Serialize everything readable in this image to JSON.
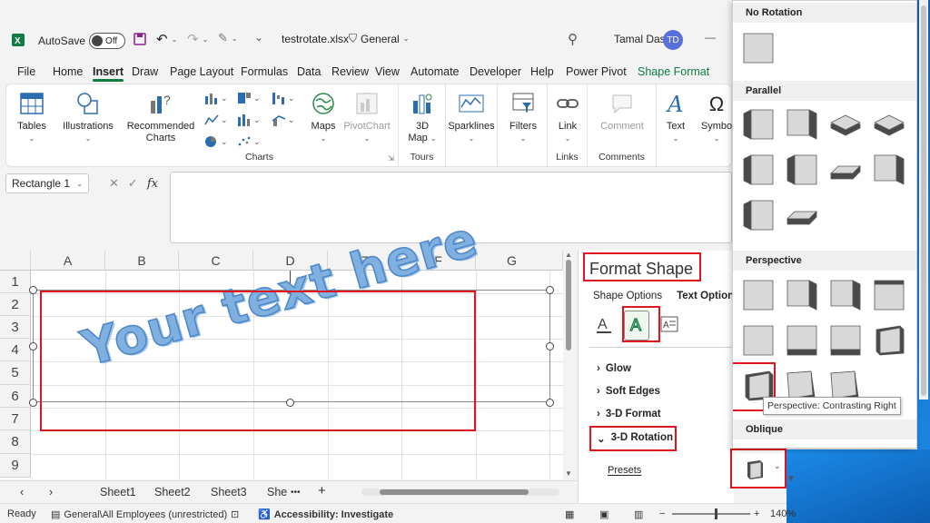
{
  "titlebar": {
    "autosave_label": "AutoSave",
    "autosave_state": "Off",
    "filename": "testrotate.xlsx",
    "sensitivity": "General",
    "user_name": "Tamal Das",
    "user_initials": "TD"
  },
  "menu_tabs": [
    "File",
    "Home",
    "Insert",
    "Draw",
    "Page Layout",
    "Formulas",
    "Data",
    "Review",
    "View",
    "Automate",
    "Developer",
    "Help",
    "Power Pivot",
    "Shape Format"
  ],
  "active_tab": "Insert",
  "ribbon": {
    "tables": "Tables",
    "illustrations": "Illustrations",
    "recommended_charts_1": "Recommended",
    "recommended_charts_2": "Charts",
    "charts_group": "Charts",
    "maps": "Maps",
    "pivotchart": "PivotChart",
    "map3d_1": "3D",
    "map3d_2": "Map",
    "tours_group": "Tours",
    "sparklines": "Sparklines",
    "filters": "Filters",
    "link": "Link",
    "links_group": "Links",
    "comment": "Comment",
    "comments_group": "Comments",
    "text": "Text",
    "symbols": "Symbo"
  },
  "formula_bar": {
    "name_box": "Rectangle 1",
    "fx": "fx",
    "cancel": "✕",
    "enter": "✓"
  },
  "grid": {
    "columns": [
      "A",
      "B",
      "C",
      "D",
      "E",
      "F",
      "G"
    ],
    "rows": [
      "1",
      "2",
      "3",
      "4",
      "5",
      "6",
      "7",
      "8",
      "9"
    ],
    "wordart_text": "Your text here"
  },
  "sheets": [
    "Sheet1",
    "Sheet2",
    "Sheet3",
    "She"
  ],
  "sheet_more": "•••",
  "sheet_add": "+",
  "status": {
    "ready": "Ready",
    "sensitivity": "General\\All Employees (unrestricted)",
    "accessibility": "Accessibility: Investigate",
    "zoom_minus": "−",
    "zoom_plus": "+",
    "zoom": "140%"
  },
  "format_pane": {
    "title": "Format Shape",
    "tab_shape": "Shape Options",
    "tab_text": "Text Options",
    "sections": [
      "Glow",
      "Soft Edges",
      "3-D Format",
      "3-D Rotation"
    ],
    "presets_label": "Presets"
  },
  "gallery": {
    "no_rotation": "No Rotation",
    "parallel": "Parallel",
    "perspective": "Perspective",
    "oblique": "Oblique",
    "tooltip": "Perspective: Contrasting Right"
  },
  "colors": {
    "excel_green": "#107c41",
    "highlight_red": "#e0141e",
    "wordart_fill": "#7fb0e0",
    "tile_face": "#d8d8d8",
    "tile_side": "#4a4a4a"
  }
}
